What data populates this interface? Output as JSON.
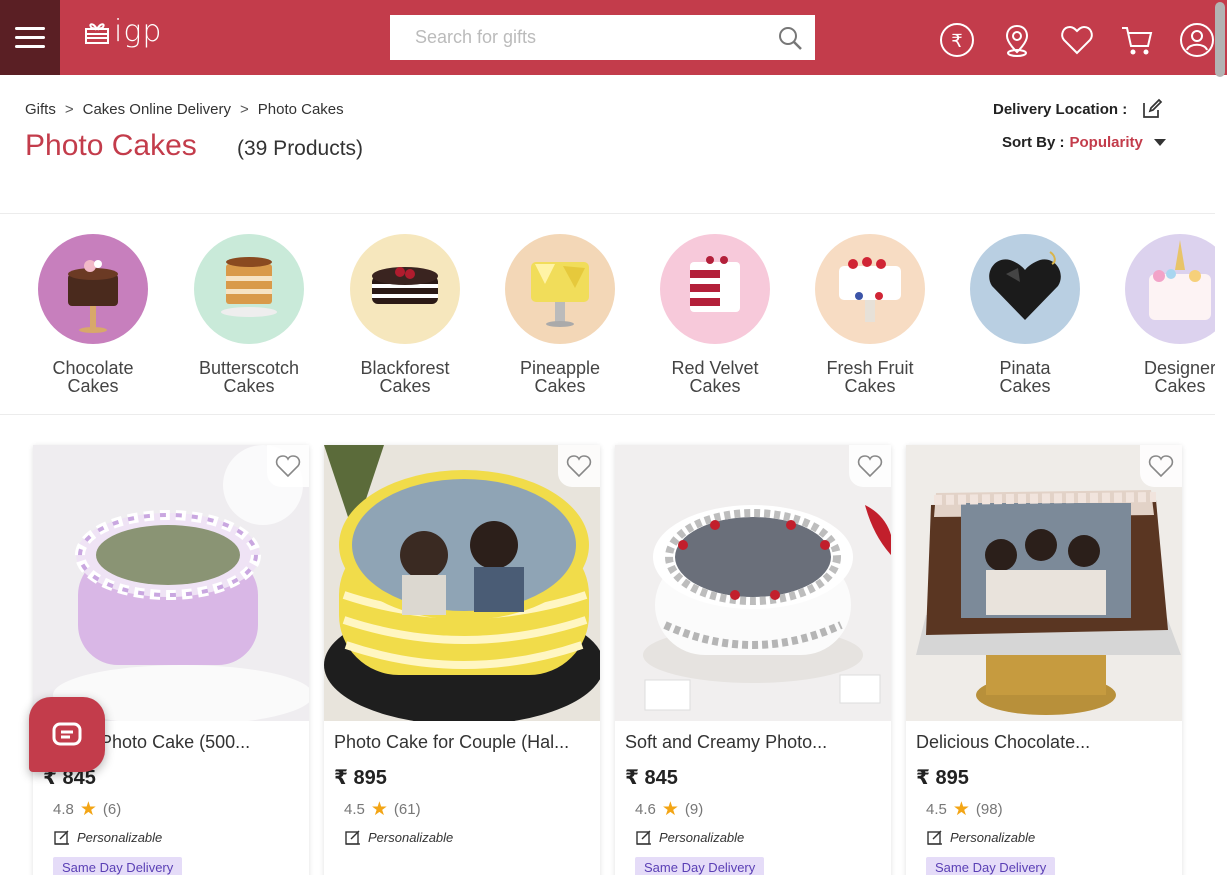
{
  "header": {
    "logo_text": "igp",
    "search_placeholder": "Search for gifts",
    "icons": [
      "rupee-icon",
      "location-icon",
      "heart-icon",
      "cart-icon",
      "user-icon"
    ],
    "brand_color": "#c33c4b"
  },
  "breadcrumb": [
    "Gifts",
    "Cakes Online Delivery",
    "Photo Cakes"
  ],
  "breadcrumb_sep": ">",
  "page": {
    "title": "Photo Cakes",
    "count": "(39 Products)",
    "delivery_label": "Delivery Location :",
    "sort_label": "Sort By :",
    "sort_value": "Popularity"
  },
  "categories": [
    {
      "line1": "Chocolate",
      "line2": "Cakes",
      "bg": "#c77fbd"
    },
    {
      "line1": "Butterscotch",
      "line2": "Cakes",
      "bg": "#c9ead9"
    },
    {
      "line1": "Blackforest",
      "line2": "Cakes",
      "bg": "#f6e7bd"
    },
    {
      "line1": "Pineapple",
      "line2": "Cakes",
      "bg": "#f3d7b7"
    },
    {
      "line1": "Red Velvet",
      "line2": "Cakes",
      "bg": "#f7c9da"
    },
    {
      "line1": "Fresh Fruit",
      "line2": "Cakes",
      "bg": "#f7dcc3"
    },
    {
      "line1": "Pinata",
      "line2": "Cakes",
      "bg": "#b9cfe2"
    },
    {
      "line1": "Designer",
      "line2": "Cakes",
      "bg": "#dcd2ee"
    }
  ],
  "products": [
    {
      "name": "Lovely Photo Cake (500...",
      "currency": "₹",
      "price": "845",
      "rating": "4.8",
      "reviews": "(6)",
      "personal": "Personalizable",
      "badge": "Same Day Delivery"
    },
    {
      "name": "Photo Cake for Couple (Hal...",
      "currency": "₹",
      "price": "895",
      "rating": "4.5",
      "reviews": "(61)",
      "personal": "Personalizable",
      "badge": ""
    },
    {
      "name": "Soft and Creamy Photo...",
      "currency": "₹",
      "price": "845",
      "rating": "4.6",
      "reviews": "(9)",
      "personal": "Personalizable",
      "badge": "Same Day Delivery"
    },
    {
      "name": "Delicious Chocolate...",
      "currency": "₹",
      "price": "895",
      "rating": "4.5",
      "reviews": "(98)",
      "personal": "Personalizable",
      "badge": "Same Day Delivery"
    }
  ]
}
